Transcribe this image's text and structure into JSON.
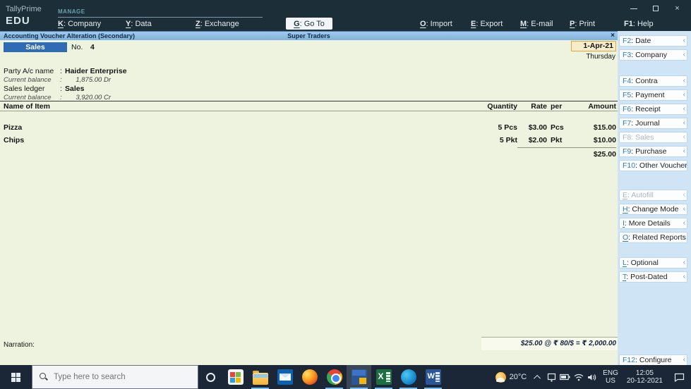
{
  "topbar": {
    "brand_top": "TallyPrime",
    "brand_bottom": "EDU",
    "section_heading": "MANAGE",
    "menu_left": [
      {
        "key": "K",
        "label": ": Company"
      },
      {
        "key": "Y",
        "label": ": Data"
      },
      {
        "key": "Z",
        "label": ": Exchange"
      }
    ],
    "goto_button": {
      "key": "G",
      "label": ": Go To"
    },
    "menu_right": [
      {
        "key": "O",
        "label": ": Import"
      },
      {
        "key": "E",
        "label": ": Export"
      },
      {
        "key": "M",
        "label": ": E-mail"
      },
      {
        "key": "P",
        "label": ": Print"
      },
      {
        "key": "F1",
        "label": ": Help"
      }
    ],
    "window_close": "×"
  },
  "titlebar": {
    "title": "Accounting Voucher Alteration (Secondary)",
    "company": "Super Traders",
    "close": "×"
  },
  "voucher": {
    "type_label": "Sales",
    "no_label": "No.",
    "no_value": "4",
    "date_value": "1-Apr-21",
    "day_value": "Thursday",
    "colon": ":",
    "party_label": "Party A/c name",
    "party_value": "Haider Enterprise",
    "party_balance_label": "Current balance",
    "party_balance_value": "1,875.00 Dr",
    "ledger_label": "Sales ledger",
    "ledger_value": "Sales",
    "ledger_balance_label": "Current balance",
    "ledger_balance_value": "3,920.00 Cr",
    "table": {
      "header_item": "Name of Item",
      "header_qty": "Quantity",
      "header_rate": "Rate",
      "header_per": "per",
      "header_amount": "Amount",
      "rows": [
        {
          "item": "Pizza",
          "qty": "5 Pcs",
          "rate": "$3.00",
          "per": "Pcs",
          "amount": "$15.00"
        },
        {
          "item": "Chips",
          "qty": "5 Pkt",
          "rate": "$2.00",
          "per": "Pkt",
          "amount": "$10.00"
        }
      ],
      "total_amount": "$25.00"
    },
    "narration_label": "Narration:",
    "forex_summary": "$25.00 @ ₹ 80/$ = ₹ 2,000.00"
  },
  "sidebar": {
    "collapse_arrow": "‹",
    "buttons": [
      {
        "key": "F2",
        "label": ": Date"
      },
      {
        "key": "F3",
        "label": ": Company"
      },
      {
        "key": "F4",
        "label": ": Contra"
      },
      {
        "key": "F5",
        "label": ": Payment"
      },
      {
        "key": "F6",
        "label": ": Receipt"
      },
      {
        "key": "F7",
        "label": ": Journal"
      },
      {
        "key": "F8",
        "label": ": Sales"
      },
      {
        "key": "F9",
        "label": ": Purchase"
      },
      {
        "key": "F10",
        "label": ": Other Vouchers"
      },
      {
        "key": "E",
        "label": ": Autofill"
      },
      {
        "key": "H",
        "label": ": Change Mode"
      },
      {
        "key": "I",
        "label": ": More Details"
      },
      {
        "key": "O",
        "label": ": Related Reports"
      },
      {
        "key": "L",
        "label": ": Optional"
      },
      {
        "key": "T",
        "label": ": Post-Dated"
      },
      {
        "key": "F12",
        "label": ": Configure"
      }
    ]
  },
  "taskbar": {
    "search_placeholder": "Type here to search",
    "icons": [
      "start",
      "search",
      "cortana",
      "store",
      "file-explorer",
      "mail",
      "firefox",
      "chrome",
      "tallyprime",
      "excel",
      "edge",
      "word"
    ],
    "tray_icons": [
      "weather",
      "tray-expand",
      "system",
      "battery",
      "wifi",
      "volume",
      "language",
      "clock",
      "notifications"
    ],
    "temperature": "20°C",
    "lang_line1": "ENG",
    "lang_line2": "US",
    "clock_time": "12:05",
    "clock_date": "20-12-2021"
  },
  "colors": {
    "topbar_bg": "#1c2e37",
    "titlebar_bg": "#8db9e2",
    "body_bg": "#edf3df",
    "sidebar_bg": "#cfe4f4",
    "accent_blue": "#2f6cb3",
    "key_blue": "#2e7cc0",
    "date_field_bg": "#f8edca",
    "date_field_border": "#dda73f",
    "taskbar_bg": "#1b2736"
  }
}
